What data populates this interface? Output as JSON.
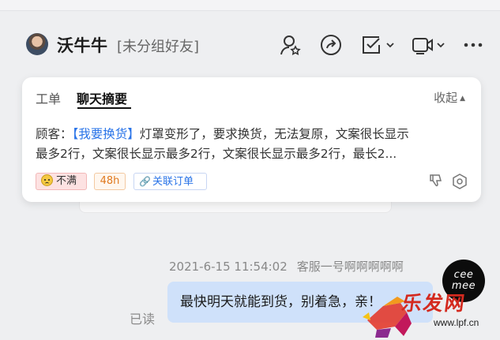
{
  "header": {
    "contact_name": "沃牛牛",
    "contact_group": "[未分组好友]"
  },
  "icons": [
    "user-star-icon",
    "share-arrow-icon",
    "checklist-icon",
    "video-camera-icon",
    "more-icon"
  ],
  "panel": {
    "tabs": [
      {
        "label": "工单",
        "active": false
      },
      {
        "label": "聊天摘要",
        "active": true
      }
    ],
    "collapse_label": "收起",
    "summary": {
      "prefix": "顾客：",
      "tag": "【我要换货】",
      "text_line1": "灯罩变形了，要求换货，无法复原，文案很长显示",
      "text_line2": "最多2行，文案很长显示最多2行，文案很长显示最多2行，最长2..."
    },
    "chips": {
      "mood": "不满",
      "duration": "48h",
      "link": "关联订单"
    }
  },
  "conversation": {
    "timestamp": "2021-6-15 11:54:02",
    "agent": "客服一号啊啊啊啊啊",
    "read_status": "已读",
    "message": "最快明天就能到货，别着急，亲！",
    "avatar_text": [
      "cee",
      "mee"
    ]
  },
  "watermark": {
    "logo_text": "乐发网",
    "url": "www.lpf.cn"
  },
  "colors": {
    "accent": "#2a74e8",
    "bubble": "#cfe1fa",
    "mood_bg": "#fde2e2",
    "time_text": "#e07a1f"
  }
}
